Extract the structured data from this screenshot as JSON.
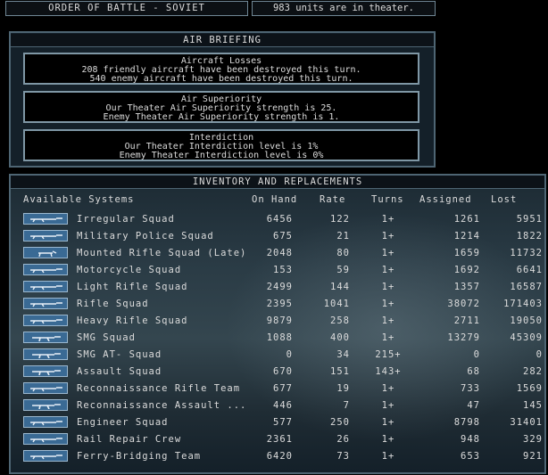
{
  "top": {
    "title": "ORDER OF BATTLE -  SOVIET",
    "units": "983 units are in theater."
  },
  "air": {
    "title": "AIR BRIEFING",
    "losses": {
      "heading": "Aircraft Losses",
      "line1": "208 friendly aircraft have been destroyed this turn.",
      "line2": "540 enemy aircraft have been destroyed this turn."
    },
    "superiority": {
      "heading": "Air Superiority",
      "line1": "Our Theater Air Superiority strength is 25.",
      "line2": "Enemy Theater Air Superiority strength is 1."
    },
    "interdiction": {
      "heading": "Interdiction",
      "line1": "Our Theater Interdiction level is 1%",
      "line2": "Enemy Theater Interdiction level is 0%"
    }
  },
  "inventory": {
    "title": "INVENTORY AND REPLACEMENTS",
    "headers": {
      "systems": "Available Systems",
      "on_hand": "On Hand",
      "rate": "Rate",
      "turns": "Turns",
      "assigned": "Assigned",
      "lost": "Lost"
    },
    "rows": [
      {
        "name": "Irregular Squad",
        "on_hand": "6456",
        "rate": "122",
        "turns": "1+",
        "assigned": "1261",
        "lost": "5951",
        "icon": "rifle-icon"
      },
      {
        "name": "Military Police Squad",
        "on_hand": "675",
        "rate": "21",
        "turns": "1+",
        "assigned": "1214",
        "lost": "1822",
        "icon": "rifle-icon"
      },
      {
        "name": "Mounted Rifle Squad (Late)",
        "on_hand": "2048",
        "rate": "80",
        "turns": "1+",
        "assigned": "1659",
        "lost": "11732",
        "icon": "horse-icon"
      },
      {
        "name": "Motorcycle Squad",
        "on_hand": "153",
        "rate": "59",
        "turns": "1+",
        "assigned": "1692",
        "lost": "6641",
        "icon": "rifle-icon"
      },
      {
        "name": "Light Rifle Squad",
        "on_hand": "2499",
        "rate": "144",
        "turns": "1+",
        "assigned": "1357",
        "lost": "16587",
        "icon": "rifle-icon"
      },
      {
        "name": "Rifle Squad",
        "on_hand": "2395",
        "rate": "1041",
        "turns": "1+",
        "assigned": "38072",
        "lost": "171403",
        "icon": "rifle-icon"
      },
      {
        "name": "Heavy Rifle Squad",
        "on_hand": "9879",
        "rate": "258",
        "turns": "1+",
        "assigned": "2711",
        "lost": "19050",
        "icon": "rifle-icon"
      },
      {
        "name": "SMG Squad",
        "on_hand": "1088",
        "rate": "400",
        "turns": "1+",
        "assigned": "13279",
        "lost": "45309",
        "icon": "smg-icon"
      },
      {
        "name": "SMG AT- Squad",
        "on_hand": "0",
        "rate": "34",
        "turns": "215+",
        "assigned": "0",
        "lost": "0",
        "icon": "smg-icon"
      },
      {
        "name": "Assault Squad",
        "on_hand": "670",
        "rate": "151",
        "turns": "143+",
        "assigned": "68",
        "lost": "282",
        "icon": "smg-icon"
      },
      {
        "name": "Reconnaissance Rifle Team",
        "on_hand": "677",
        "rate": "19",
        "turns": "1+",
        "assigned": "733",
        "lost": "1569",
        "icon": "rifle-icon"
      },
      {
        "name": "Reconnaissance Assault ...",
        "on_hand": "446",
        "rate": "7",
        "turns": "1+",
        "assigned": "47",
        "lost": "145",
        "icon": "smg-icon"
      },
      {
        "name": "Engineer Squad",
        "on_hand": "577",
        "rate": "250",
        "turns": "1+",
        "assigned": "8798",
        "lost": "31401",
        "icon": "rifle-icon"
      },
      {
        "name": "Rail Repair Crew",
        "on_hand": "2361",
        "rate": "26",
        "turns": "1+",
        "assigned": "948",
        "lost": "329",
        "icon": "rifle-icon"
      },
      {
        "name": "Ferry-Bridging Team",
        "on_hand": "6420",
        "rate": "73",
        "turns": "1+",
        "assigned": "653",
        "lost": "921",
        "icon": "rifle-icon"
      }
    ]
  }
}
